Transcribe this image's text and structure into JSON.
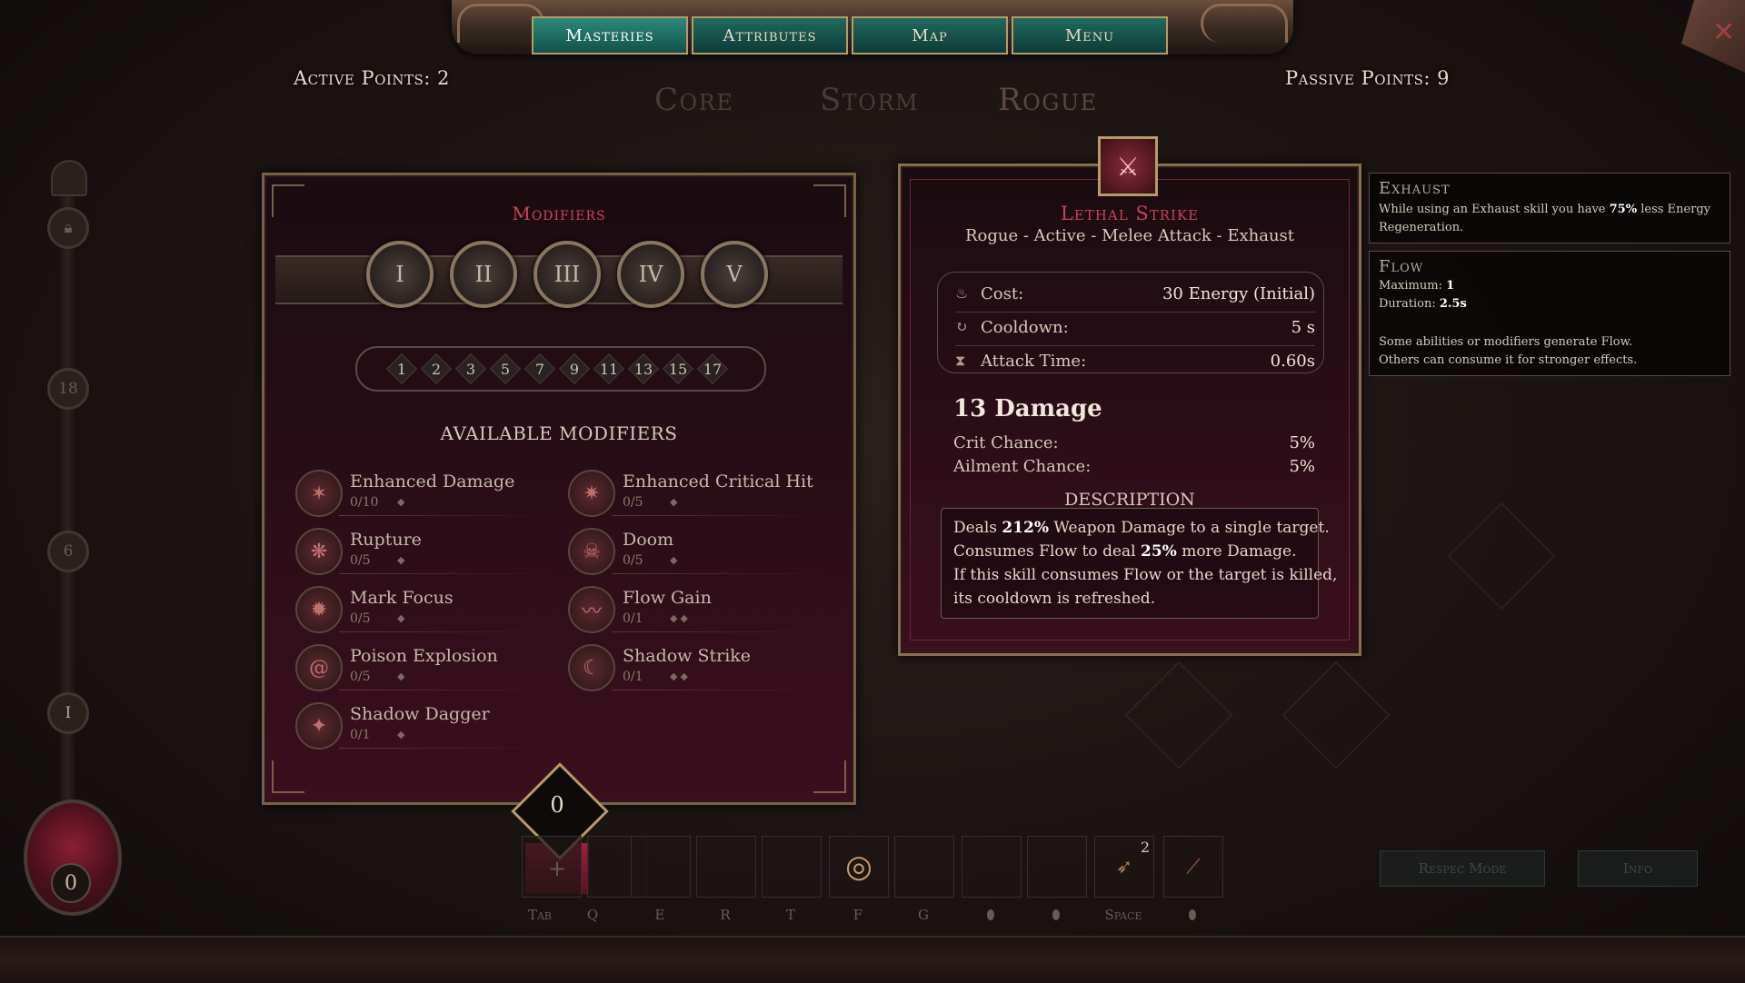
{
  "nav": {
    "tabs": [
      {
        "label": "Masteries",
        "active": true
      },
      {
        "label": "Attributes",
        "active": false
      },
      {
        "label": "Map",
        "active": false
      },
      {
        "label": "Menu",
        "active": false
      }
    ]
  },
  "points": {
    "active": "Active Points: 2",
    "passive": "Passive Points: 9"
  },
  "mastery_tabs": [
    "Core",
    "Storm",
    "Rogue"
  ],
  "level_track": {
    "nodes": [
      "18",
      "6",
      "I"
    ],
    "orb_value": "0"
  },
  "modifiers": {
    "title": "Modifiers",
    "tiers": [
      "I",
      "II",
      "III",
      "IV",
      "V"
    ],
    "levels": [
      "1",
      "2",
      "3",
      "5",
      "7",
      "9",
      "11",
      "13",
      "15",
      "17"
    ],
    "available_label": "AVAILABLE MODIFIERS",
    "items": [
      {
        "name": "Enhanced Damage",
        "count": "0/10",
        "pips": "◆"
      },
      {
        "name": "Enhanced Critical Hit",
        "count": "0/5",
        "pips": "◆"
      },
      {
        "name": "Rupture",
        "count": "0/5",
        "pips": "◆"
      },
      {
        "name": "Doom",
        "count": "0/5",
        "pips": "◆"
      },
      {
        "name": "Mark Focus",
        "count": "0/5",
        "pips": "◆"
      },
      {
        "name": "Flow Gain",
        "count": "0/1",
        "pips": "◆◆"
      },
      {
        "name": "Poison Explosion",
        "count": "0/5",
        "pips": "◆"
      },
      {
        "name": "Shadow Strike",
        "count": "0/1",
        "pips": "◆◆"
      },
      {
        "name": "Shadow Dagger",
        "count": "0/1",
        "pips": "◆"
      }
    ],
    "counter": "0",
    "add_symbol": "+"
  },
  "skill": {
    "title": "Lethal Strike",
    "subtitle": "Rogue - Active - Melee Attack - Exhaust",
    "stats": [
      {
        "label": "Cost:",
        "value": "30 Energy (Initial)",
        "icon": "energy-icon"
      },
      {
        "label": "Cooldown:",
        "value": "5 s",
        "icon": "cooldown-icon"
      },
      {
        "label": "Attack Time:",
        "value": "0.60s",
        "icon": "hourglass-icon"
      }
    ],
    "damage": "13 Damage",
    "crit_label": "Crit Chance:",
    "crit_value": "5%",
    "ailment_label": "Ailment Chance:",
    "ailment_value": "5%",
    "description_label": "DESCRIPTION",
    "description": {
      "l1a": "Deals ",
      "l1b": "212%",
      "l1c": " Weapon Damage to a single target.",
      "l2a": "Consumes Flow to deal ",
      "l2b": "25%",
      "l2c": " more Damage.",
      "l3": "If this skill consumes Flow or the target is killed,",
      "l4": "its cooldown is refreshed."
    }
  },
  "tooltips": {
    "exhaust": {
      "title": "Exhaust",
      "l1a": "While using an Exhaust skill you have ",
      "l1b": "75%",
      "l1c": " less Energy",
      "l2": "Regeneration."
    },
    "flow": {
      "title": "Flow",
      "max_label": "Maximum: ",
      "max_value": "1",
      "dur_label": "Duration: ",
      "dur_value": "2.5s",
      "l3": "Some abilities or modifiers generate Flow.",
      "l4": "Others can consume it for stronger effects."
    }
  },
  "hotbar": {
    "keys": [
      "Tab",
      "Q",
      "E",
      "R",
      "T",
      "F",
      "G",
      "",
      "",
      "Space",
      ""
    ],
    "slot_badge": "2"
  },
  "buttons": {
    "respec": "Respec Mode",
    "info": "Info"
  },
  "colors": {
    "accent": "#c8435a",
    "panel": "#2d0d18",
    "nav": "#1f6a60",
    "gold": "#b59a6a"
  }
}
